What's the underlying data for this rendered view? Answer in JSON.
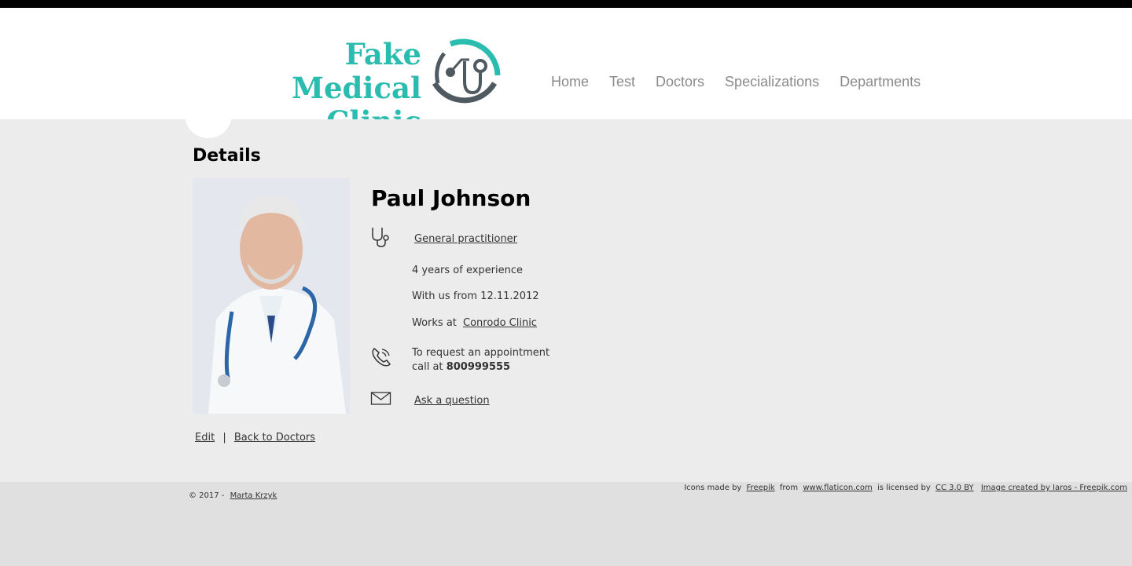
{
  "header": {
    "logo_line1": "Fake",
    "logo_line2": "Medical Clinic",
    "nav": [
      "Home",
      "Test",
      "Doctors",
      "Specializations",
      "Departments"
    ]
  },
  "main": {
    "title": "Details",
    "doctor": {
      "name": "Paul Johnson",
      "specialization": "General practitioner",
      "experience": "4 years of experience",
      "with_us_from": "With us from 12.11.2012",
      "works_at_label": "Works at",
      "clinic": "Conrodo Clinic",
      "appointment_line1": "To request an appointment",
      "appointment_call": "call at",
      "phone": "800999555",
      "ask": "Ask a question"
    },
    "actions": {
      "edit": "Edit",
      "separator": "|",
      "back": "Back to Doctors"
    }
  },
  "footer": {
    "copyright": "© 2017 -",
    "author": "Marta Krzyk",
    "icons_made_by": "Icons made by",
    "freepik": "Freepik",
    "from": "from",
    "flaticon": "www.flaticon.com",
    "licensed_by": "is licensed by",
    "cc": "CC 3.0 BY",
    "image_credit": "Image created by Iaros - Freepik.com"
  },
  "colors": {
    "accent": "#2bbcb0",
    "nav": "#8a8a8a",
    "background": "#ececec",
    "footer": "#e0e0e0"
  },
  "icons": [
    "stethoscope-logo-icon",
    "stethoscope-icon",
    "phone-icon",
    "envelope-icon"
  ]
}
